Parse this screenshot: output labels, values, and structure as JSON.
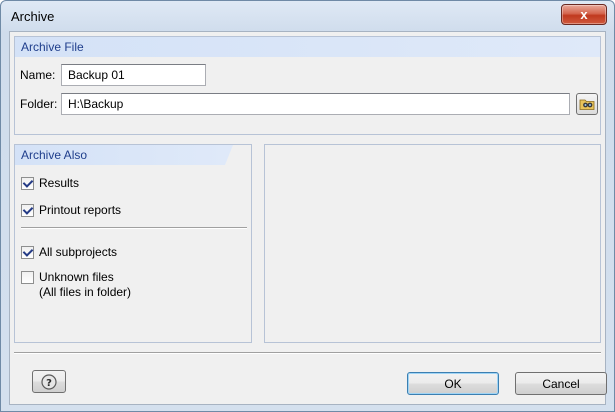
{
  "window": {
    "title": "Archive",
    "close_glyph": "x"
  },
  "archive_file": {
    "header": "Archive File",
    "name_label": "Name:",
    "name_value": "Backup 01",
    "folder_label": "Folder:",
    "folder_value": "H:\\Backup",
    "browse_icon": "folder-browse-icon"
  },
  "archive_also": {
    "header": "Archive Also",
    "options": [
      {
        "label": "Results",
        "checked": true
      },
      {
        "label": "Printout reports",
        "checked": true
      },
      {
        "label": "All subprojects",
        "checked": true
      },
      {
        "label_line1": "Unknown files",
        "label_line2": "(All files in folder)",
        "checked": false
      }
    ]
  },
  "footer": {
    "ok_label": "OK",
    "cancel_label": "Cancel",
    "help_icon": "help-icon"
  },
  "colors": {
    "group_header_text": "#1f3e8c",
    "group_header_bg": "#d4e2f7",
    "close_button": "#c0391f"
  }
}
